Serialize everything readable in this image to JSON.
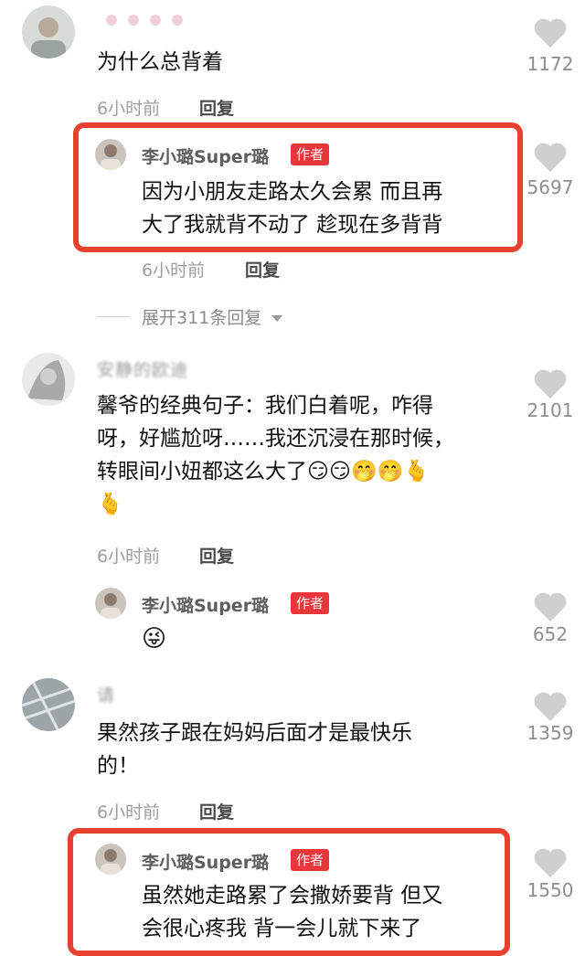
{
  "comments": [
    {
      "username": "",
      "text_lines": [
        "为什么总背着"
      ],
      "time": "6小时前",
      "reply_label": "回复",
      "likes": "1172",
      "replies": [
        {
          "author": "李小璐Super璐",
          "badge": "作者",
          "text_lines": [
            "因为小朋友走路太久会累 而且再",
            "大了我就背不动了 趁现在多背背"
          ],
          "time": "6小时前",
          "reply_label": "回复",
          "likes": "5697"
        }
      ],
      "expand_label": "展开311条回复"
    },
    {
      "username": "安静的欧迪",
      "text_lines": [
        "馨爷的经典句子：我们白着呢，咋得",
        "呀，好尴尬呀……我还沉浸在那时候，",
        "转眼间小妞都这么大了😏😏🤭🤭🫰"
      ],
      "extra_line": "🫰",
      "time": "6小时前",
      "reply_label": "回复",
      "likes": "2101",
      "replies": [
        {
          "author": "李小璐Super璐",
          "badge": "作者",
          "text_lines": [
            "😜"
          ],
          "likes": "652"
        }
      ]
    },
    {
      "username": "请",
      "text_lines": [
        "果然孩子跟在妈妈后面才是最快乐",
        "的！"
      ],
      "time": "6小时前",
      "reply_label": "回复",
      "likes": "1359",
      "replies": [
        {
          "author": "李小璐Super璐",
          "badge": "作者",
          "text_lines": [
            "虽然她走路累了会撒娇要背 但又",
            "会很心疼我 背一会儿就下来了"
          ],
          "likes": "1550"
        }
      ]
    }
  ],
  "colors": {
    "badge": "#e8373b",
    "highlight": "#e8412f",
    "heart": "#cfcfcf"
  }
}
